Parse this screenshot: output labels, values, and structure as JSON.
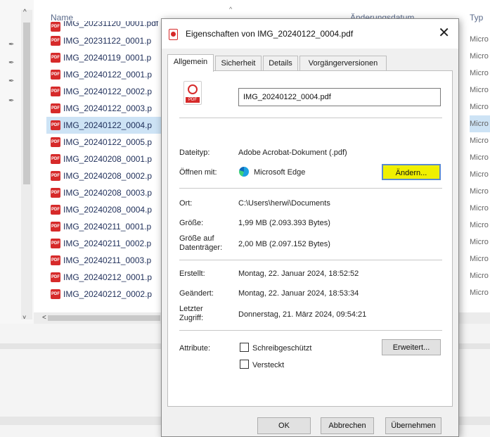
{
  "explorer": {
    "columns": {
      "name": "Name",
      "date": "Änderungsdatum",
      "type": "Typ"
    },
    "top_cut_file": "IMG_20231120_0001.pdf",
    "files": [
      "IMG_20231122_0001.p",
      "IMG_20240119_0001.p",
      "IMG_20240122_0001.p",
      "IMG_20240122_0002.p",
      "IMG_20240122_0003.p",
      "IMG_20240122_0004.p",
      "IMG_20240122_0005.p",
      "IMG_20240208_0001.p",
      "IMG_20240208_0002.p",
      "IMG_20240208_0003.p",
      "IMG_20240208_0004.p",
      "IMG_20240211_0001.p",
      "IMG_20240211_0002.p",
      "IMG_20240211_0003.p",
      "IMG_20240212_0001.p",
      "IMG_20240212_0002.p"
    ],
    "selected_index": 5,
    "file_icon_label": "PDF",
    "type_cell": "Micro"
  },
  "dialog": {
    "title": "Eigenschaften von IMG_20240122_0004.pdf",
    "close": "✕",
    "tabs": [
      "Allgemein",
      "Sicherheit",
      "Details",
      "Vorgängerversionen"
    ],
    "filename_value": "IMG_20240122_0004.pdf",
    "pdf_icon_label": "PDF",
    "filetype_label": "Dateityp:",
    "filetype_value": "Adobe Acrobat-Dokument (.pdf)",
    "openwith_label": "Öffnen mit:",
    "openwith_value": "Microsoft Edge",
    "change_button": "Ändern...",
    "location_label": "Ort:",
    "location_value": "C:\\Users\\herwi\\Documents",
    "size_label": "Größe:",
    "size_value": "1,99 MB (2.093.393 Bytes)",
    "disksize_label_1": "Größe auf",
    "disksize_label_2": "Datenträger:",
    "disksize_value": "2,00 MB (2.097.152 Bytes)",
    "created_label": "Erstellt:",
    "created_value": "Montag, 22. Januar 2024, 18:52:52",
    "modified_label": "Geändert:",
    "modified_value": "Montag, 22. Januar 2024, 18:53:34",
    "accessed_label_1": "Letzter",
    "accessed_label_2": "Zugriff:",
    "accessed_value": "Donnerstag, 21. März 2024, 09:54:21",
    "attributes_label": "Attribute:",
    "readonly_label": "Schreibgeschützt",
    "hidden_label": "Versteckt",
    "advanced_button": "Erweitert...",
    "ok_button": "OK",
    "cancel_button": "Abbrechen",
    "apply_button": "Übernehmen"
  },
  "icons": {
    "pin": "📌",
    "up": "^",
    "down": "˅",
    "left": "<"
  }
}
